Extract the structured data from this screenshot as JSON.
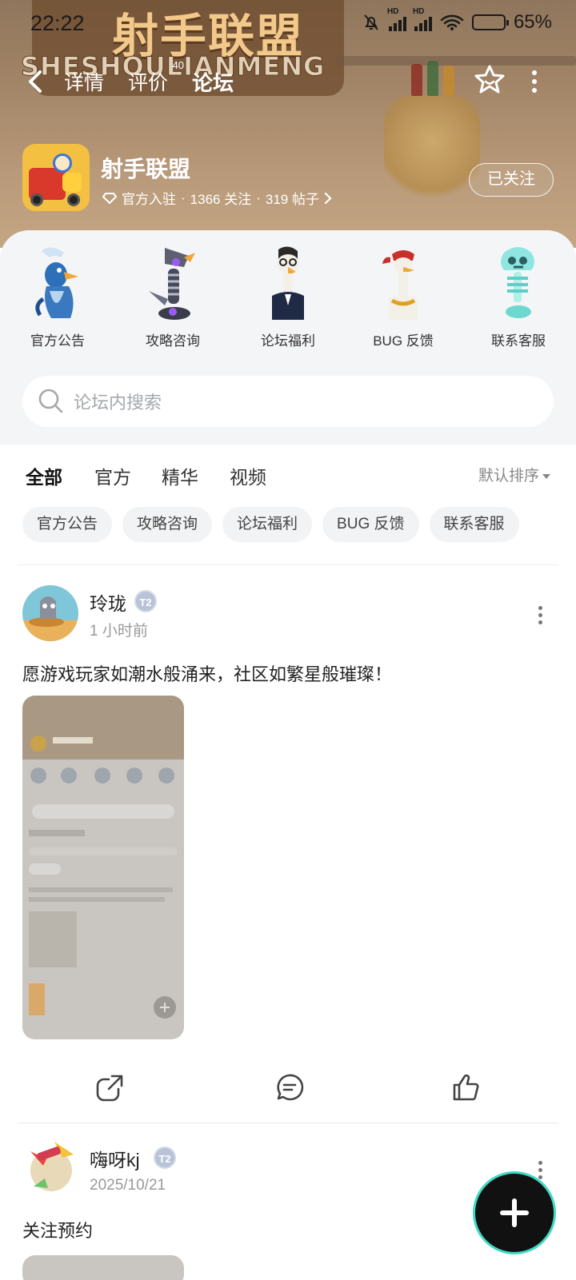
{
  "status_bar": {
    "time": "22:22",
    "battery_label": "65%",
    "battery_level": 0.62,
    "signal_label": "HD"
  },
  "header": {
    "logo_title": "射手联盟",
    "logo_subtitle": "SHESHOULIANMENG",
    "tabs": [
      {
        "label": "详情"
      },
      {
        "label": "评价",
        "badge": "40"
      },
      {
        "label": "论坛"
      }
    ]
  },
  "game": {
    "name": "射手联盟",
    "official_label": "官方入驻",
    "followers": "1366 关注",
    "posts": "319 帖子",
    "meta_sep": "·",
    "follow_button": "已关注"
  },
  "categories": [
    {
      "label": "官方公告",
      "icon": "blue-penguin-icon"
    },
    {
      "label": "攻略咨询",
      "icon": "robot-bird-icon"
    },
    {
      "label": "论坛福利",
      "icon": "suit-goose-icon"
    },
    {
      "label": "BUG 反馈",
      "icon": "bandana-goose-icon"
    },
    {
      "label": "联系客服",
      "icon": "ghost-skeleton-icon"
    }
  ],
  "search": {
    "placeholder": "论坛内搜索"
  },
  "filter_tabs": [
    {
      "label": "全部",
      "active": true
    },
    {
      "label": "官方"
    },
    {
      "label": "精华"
    },
    {
      "label": "视频"
    }
  ],
  "sort_label": "默认排序",
  "chips": [
    "官方公告",
    "攻略咨询",
    "论坛福利",
    "BUG 反馈",
    "联系客服"
  ],
  "posts": [
    {
      "author": "玲珑",
      "level": "T2",
      "time": "1 小时前",
      "text": "愿游戏玩家如潮水般涌来，社区如繁星般璀璨！"
    },
    {
      "author": "嗨呀kj",
      "level": "T2",
      "time": "2025/10/21",
      "text": "关注预约"
    }
  ],
  "colors": {
    "accent": "#3fd9c5",
    "fab_ring": "#7b47e0"
  }
}
